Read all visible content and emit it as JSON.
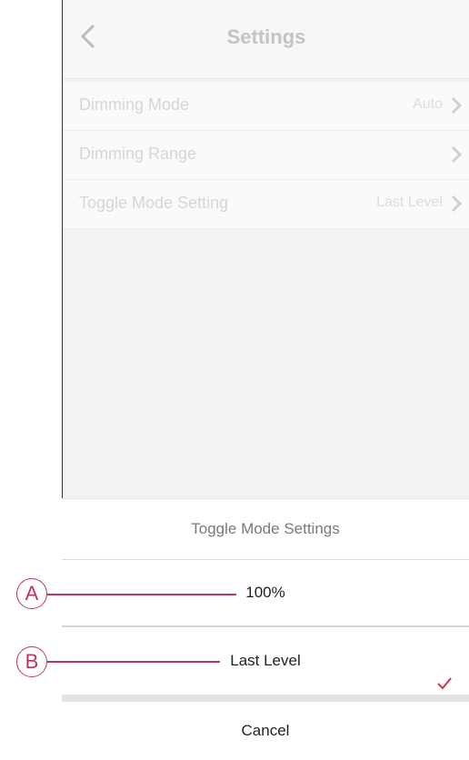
{
  "nav": {
    "title": "Settings"
  },
  "settings_rows": [
    {
      "label": "Dimming Mode",
      "value": "Auto"
    },
    {
      "label": "Dimming Range",
      "value": ""
    },
    {
      "label": "Toggle Mode Setting",
      "value": "Last Level"
    }
  ],
  "sheet": {
    "title": "Toggle Mode Settings",
    "options": [
      {
        "label": "100%",
        "selected": false
      },
      {
        "label": "Last Level",
        "selected": true
      }
    ],
    "cancel": "Cancel"
  },
  "callouts": [
    "A",
    "B"
  ],
  "colors": {
    "accent": "#c0365a",
    "check": "#d9304b"
  }
}
